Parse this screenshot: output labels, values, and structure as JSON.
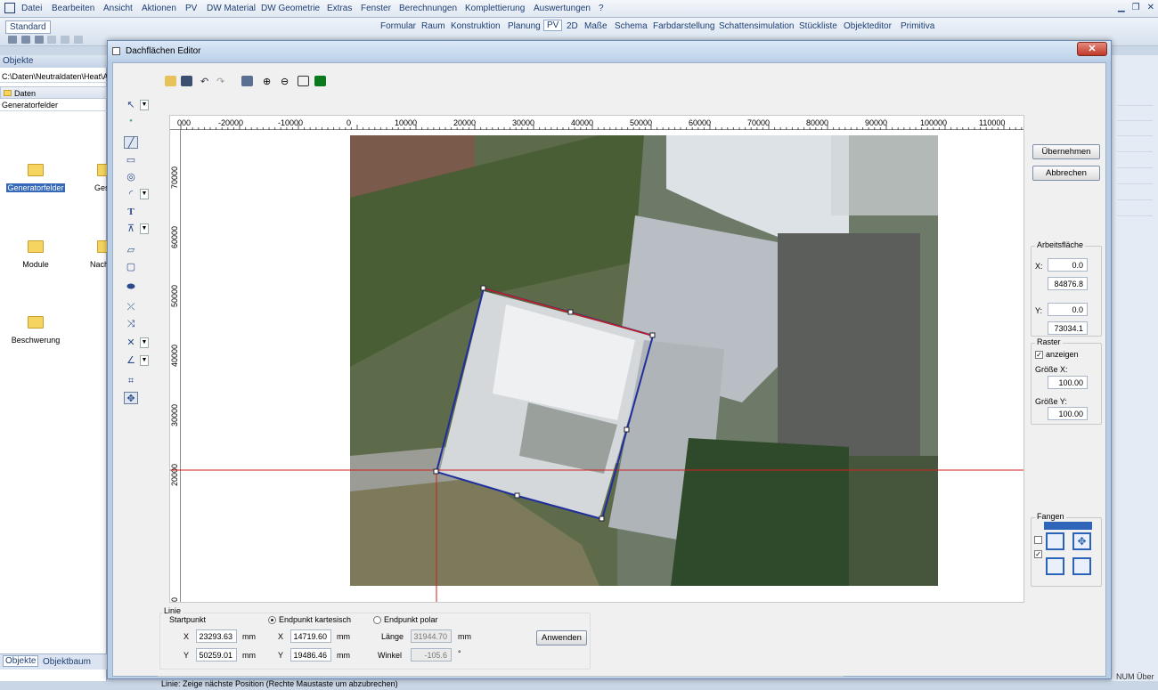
{
  "menubar": {
    "items": [
      "Datei",
      "Bearbeiten",
      "Ansicht",
      "Aktionen",
      "PV",
      "DW Material",
      "DW Geometrie",
      "Extras",
      "Fenster",
      "Berechnungen",
      "Komplettierung",
      "Auswertungen",
      "?"
    ]
  },
  "toolbar": {
    "profile": "Standard"
  },
  "ribbon_tabs": [
    "Formular",
    "Raum",
    "Konstruktion",
    "Planung",
    "PV",
    "2D",
    "Maße",
    "Schema",
    "Farbdarstellung",
    "Schattensimulation",
    "Stückliste",
    "Objekteditor",
    "Primitiva"
  ],
  "left_panel": {
    "header": "Objekte",
    "path": "C:\\Daten\\Neutraldaten\\Heat\\A",
    "root": "Daten",
    "sub": "Generatorfelder",
    "folders": [
      "Generatorfelder",
      "Gesta",
      "Module",
      "Nachbar",
      "Beschwerung"
    ],
    "tabs": [
      "Objekte",
      "Objektbaum"
    ]
  },
  "dialog": {
    "title": "Dachflächen Editor",
    "close": "✕",
    "hruler": [
      "000",
      "-20000",
      "-10000",
      "0",
      "10000",
      "20000",
      "30000",
      "40000",
      "50000",
      "60000",
      "70000",
      "80000",
      "90000",
      "100000",
      "110000"
    ],
    "vruler": [
      "70000",
      "60000",
      "50000",
      "40000",
      "30000",
      "20000",
      "0"
    ],
    "buttons": {
      "apply": "Übernehmen",
      "cancel": "Abbrechen",
      "anwenden": "Anwenden"
    },
    "arbeitsflaeche": {
      "label": "Arbeitsfläche",
      "x_label": "X:",
      "y_label": "Y:",
      "x1": "0.0",
      "x2": "84876.8",
      "y1": "0.0",
      "y2": "73034.1"
    },
    "raster": {
      "label": "Raster",
      "show": "anzeigen",
      "gx_label": "Größe X:",
      "gx": "100.00",
      "gy_label": "Größe Y:",
      "gy": "100.00"
    },
    "fangen": {
      "label": "Fangen"
    },
    "linie": {
      "label": "Linie",
      "start": "Startpunkt",
      "mode_cart": "Endpunkt kartesisch",
      "mode_polar": "Endpunkt polar",
      "x_label": "X",
      "y_label": "Y",
      "sx": "23293.63",
      "sy": "50259.01",
      "ex": "14719.60",
      "ey": "19486.46",
      "unit": "mm",
      "len_label": "Länge",
      "len": "31944.70",
      "ang_label": "Winkel",
      "ang": "-105.6",
      "ang_unit": "°"
    },
    "status": "Linie: Zeige nächste Position (Rechte Maustaste um abzubrechen)"
  },
  "status_right": "NUM Über"
}
